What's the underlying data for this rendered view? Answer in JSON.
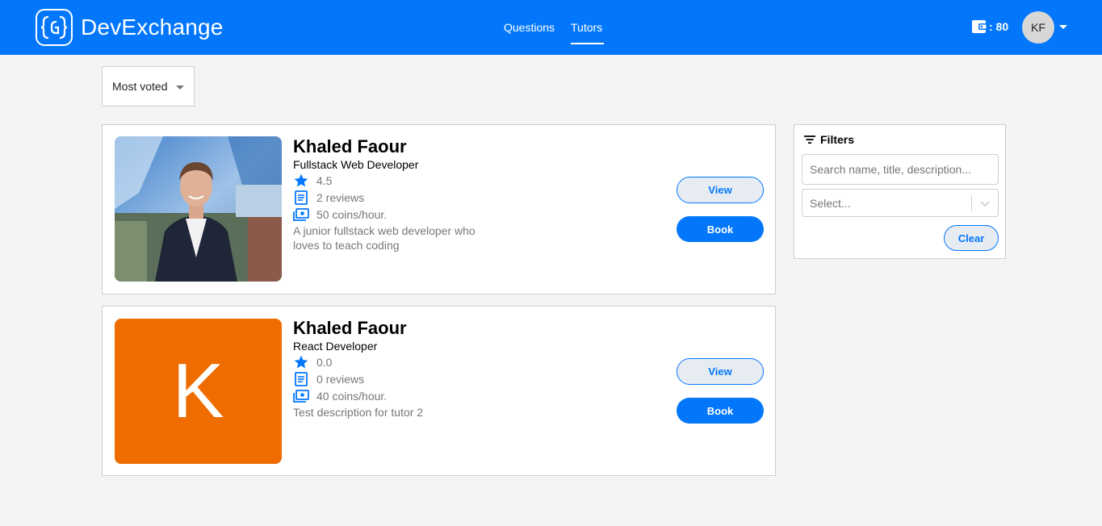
{
  "app": {
    "name": "DevExchange"
  },
  "nav": {
    "questions": "Questions",
    "tutors": "Tutors",
    "active": "Tutors"
  },
  "user": {
    "coins": ": 80",
    "initials": "KF"
  },
  "sort": {
    "selected": "Most voted"
  },
  "tutors": [
    {
      "name": "Khaled Faour",
      "title": "Fullstack Web Developer",
      "rating": "4.5",
      "reviews": "2 reviews",
      "rate": "50 coins/hour.",
      "description": "A junior fullstack web developer who loves to teach coding",
      "view_label": "View",
      "book_label": "Book"
    },
    {
      "name": "Khaled Faour",
      "title": "React Developer",
      "rating": "0.0",
      "reviews": "0 reviews",
      "rate": "40 coins/hour.",
      "description": "Test description for tutor 2",
      "avatar_letter": "K",
      "view_label": "View",
      "book_label": "Book"
    }
  ],
  "filters": {
    "heading": "Filters",
    "search_placeholder": "Search name, title, description...",
    "select_placeholder": "Select...",
    "clear_label": "Clear"
  },
  "colors": {
    "primary": "#0377fc",
    "avatar_orange": "#ef6c00",
    "background": "#f4f4f4"
  }
}
